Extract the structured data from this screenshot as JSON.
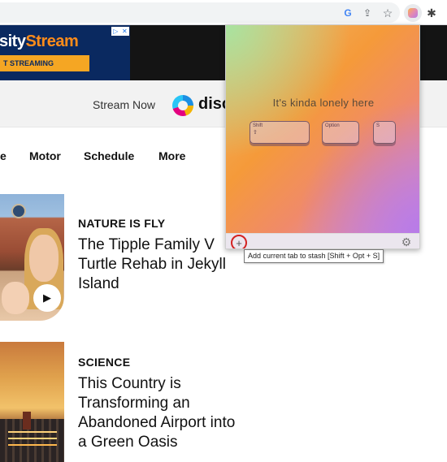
{
  "browser": {
    "toolbar_icons": [
      "google-icon",
      "share-icon",
      "star-icon",
      "extension-stash-icon",
      "puzzle-icon"
    ],
    "google_glyph": "G",
    "share_glyph": "⇪",
    "star_glyph": "☆",
    "puzzle_glyph": "✱"
  },
  "ad": {
    "brand_prefix": "sity",
    "brand_highlight": "Stream",
    "cta": "T STREAMING",
    "adchoice_left": "▷",
    "adchoice_right": "✕"
  },
  "stream_band": {
    "label": "Stream Now",
    "partner_text": "disc"
  },
  "nav": {
    "items": [
      "e",
      "Motor",
      "Schedule",
      "More"
    ]
  },
  "articles": [
    {
      "category": "NATURE IS FLY",
      "headline_lines": [
        "The Tipple Family V",
        "Turtle Rehab in Jekyll",
        "Island"
      ],
      "play_glyph": "▶"
    },
    {
      "category": "SCIENCE",
      "headline_lines": [
        "This Country is",
        "Transforming an",
        "Abandoned Airport into",
        "a Green Oasis"
      ]
    }
  ],
  "popup": {
    "empty_message": "It's kinda lonely here",
    "keys": [
      {
        "label": "Shift",
        "symbol": "⇧"
      },
      {
        "label": "Option",
        "symbol": ""
      },
      {
        "label": "S",
        "symbol": ""
      }
    ],
    "add_glyph": "+",
    "settings_glyph": "⚙",
    "colors": {
      "gradient_start": "#a8e3a0",
      "gradient_mid": "#f59a3a",
      "gradient_end": "#b77be8"
    }
  },
  "tooltip": {
    "text": "Add current tab to stash [Shift + Opt + S]"
  }
}
